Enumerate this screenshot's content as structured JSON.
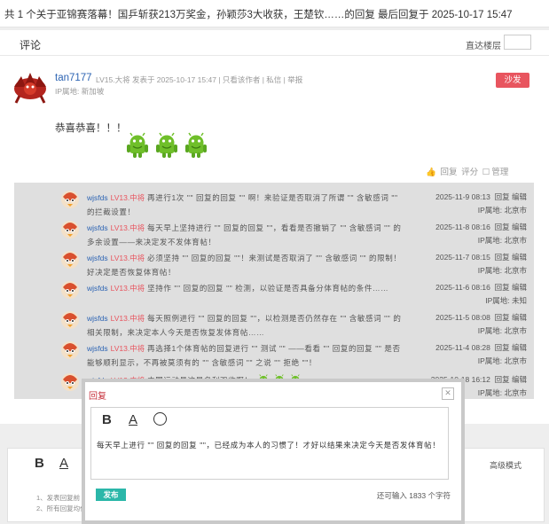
{
  "page": {
    "title": "共 1 个关于亚锦赛落幕！国乒斩获213万奖金，孙颖莎3大收获，王楚钦……的回复 最后回复于 2025-10-17 15:47"
  },
  "header": {
    "label": "评论",
    "jump_label": "直达楼层"
  },
  "post": {
    "username": "tan7177",
    "meta": "LV15.大将  发表于 2025-10-17 15:47  |  只看该作者  |  私信  |  举报",
    "ip": "IP属地: 新加坡",
    "sofa": "沙发",
    "content": "恭喜恭喜！！！",
    "actions": {
      "reply": "回复",
      "rate": "评分",
      "manage": "管理"
    }
  },
  "replies": [
    {
      "user": "wjsfds",
      "level": "LV13.中将",
      "text": "再进行1次 \"\" 回复的回复 \"\" 啊！来验证是否取消了所谓 \"\" 含敏感词 \"\" 的拦截设置！",
      "time": "2025-11-9 08:13",
      "ops": "回复 编辑",
      "ip": "IP属地: 北京市"
    },
    {
      "user": "wjsfds",
      "level": "LV13.中将",
      "text": "每天早上坚持进行 \"\" 回复的回复 \"\"，看看是否撤销了 \"\" 含敏感词 \"\" 的多余设置——来决定发不发体育帖！",
      "time": "2025-11-8 08:16",
      "ops": "回复 编辑",
      "ip": "IP属地: 北京市"
    },
    {
      "user": "wjsfds",
      "level": "LV13.中将",
      "text": "必须坚持 \"\" 回复的回复 \"\"！来测试是否取消了 \"\" 含敏感词 \"\" 的限制！好决定是否恢复体育帖！",
      "time": "2025-11-7 08:15",
      "ops": "回复 编辑",
      "ip": "IP属地: 北京市"
    },
    {
      "user": "wjsfds",
      "level": "LV13.中将",
      "text": "坚持作 \"\" 回复的回复 \"\" 检测，以验证是否具备分体育帖的条件……",
      "time": "2025-11-6 08:16",
      "ops": "回复 编辑",
      "ip": "IP属地: 未知"
    },
    {
      "user": "wjsfds",
      "level": "LV13.中将",
      "text": "每天照例进行 \"\" 回复的回复 \"\"，以检测是否仍然存在 \"\" 含敏感词 \"\" 的相关限制，来决定本人今天是否恢复发体育帖……",
      "time": "2025-11-5 08:08",
      "ops": "回复 编辑",
      "ip": "IP属地: 北京市"
    },
    {
      "user": "wjsfds",
      "level": "LV13.中将",
      "text": "再选择1个体育帖的回复进行 \"\" 测试 \"\" ——看看 \"\" 回复的回复 \"\" 是否能够顺利显示，不再被莫须有的 \"\" 含敏感词 \"\" 之说 \"\" 拒绝 \"\"！",
      "time": "2025-11-4 08:28",
      "ops": "回复 编辑",
      "ip": "IP属地: 北京市"
    },
    {
      "user": "wjsfds",
      "level": "LV13.中将",
      "text": "中国运动员这是名利双收啊！",
      "time": "2025-10-18 16:12",
      "ops": "回复 编辑",
      "ip": "IP属地: 北京市"
    }
  ],
  "dialog": {
    "title": "回复",
    "text": "每天早上进行 \"\" 回复的回复 \"\"，已经成为本人的习惯了！才好以结果来决定今天是否发体育帖！",
    "publish": "发布",
    "remain": "还可输入 1833 个字符"
  },
  "lower": {
    "advanced": "高级模式",
    "tip1": "1、发表回复前",
    "tip2": "2、所有回复均代表Jsohani个人意见，不代表官方立场。"
  },
  "colors": {
    "accent": "#2d64b3",
    "sofa": "#e8555f",
    "publish": "#2bb7a9",
    "reply_bg": "#dfdfdf"
  },
  "icons": [
    "close-icon",
    "thumbs-up-icon",
    "emoji-icon",
    "android-sticker-icon",
    "dragon-avatar-icon"
  ]
}
